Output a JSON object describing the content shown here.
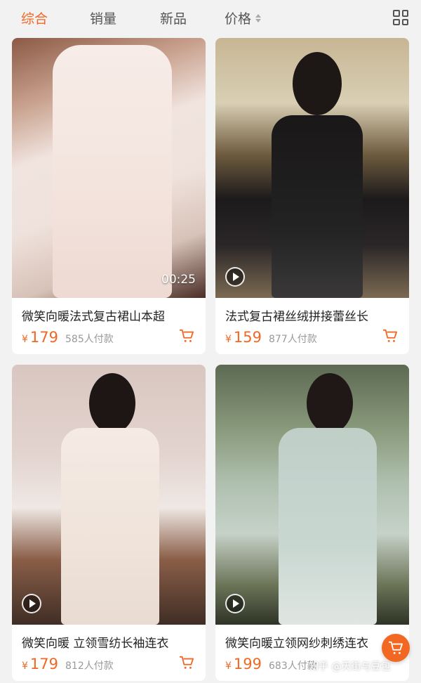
{
  "tabs": {
    "comprehensive": "综合",
    "sales": "销量",
    "new": "新品",
    "price": "价格"
  },
  "accent_color": "#f26722",
  "products": [
    {
      "title": "微笑向暖法式复古裙山本超",
      "price_symbol": "¥",
      "price": "179",
      "paid": "585人付款",
      "duration": "00:25"
    },
    {
      "title": "法式复古裙丝绒拼接蕾丝长",
      "price_symbol": "¥",
      "price": "159",
      "paid": "877人付款"
    },
    {
      "title": "微笑向暖 立领雪纺长袖连衣",
      "price_symbol": "¥",
      "price": "179",
      "paid": "812人付款"
    },
    {
      "title": "微笑向暖立领网纱刺绣连衣",
      "price_symbol": "¥",
      "price": "199",
      "paid": "683人付款"
    }
  ],
  "watermark": "知乎 @天街与豆包"
}
